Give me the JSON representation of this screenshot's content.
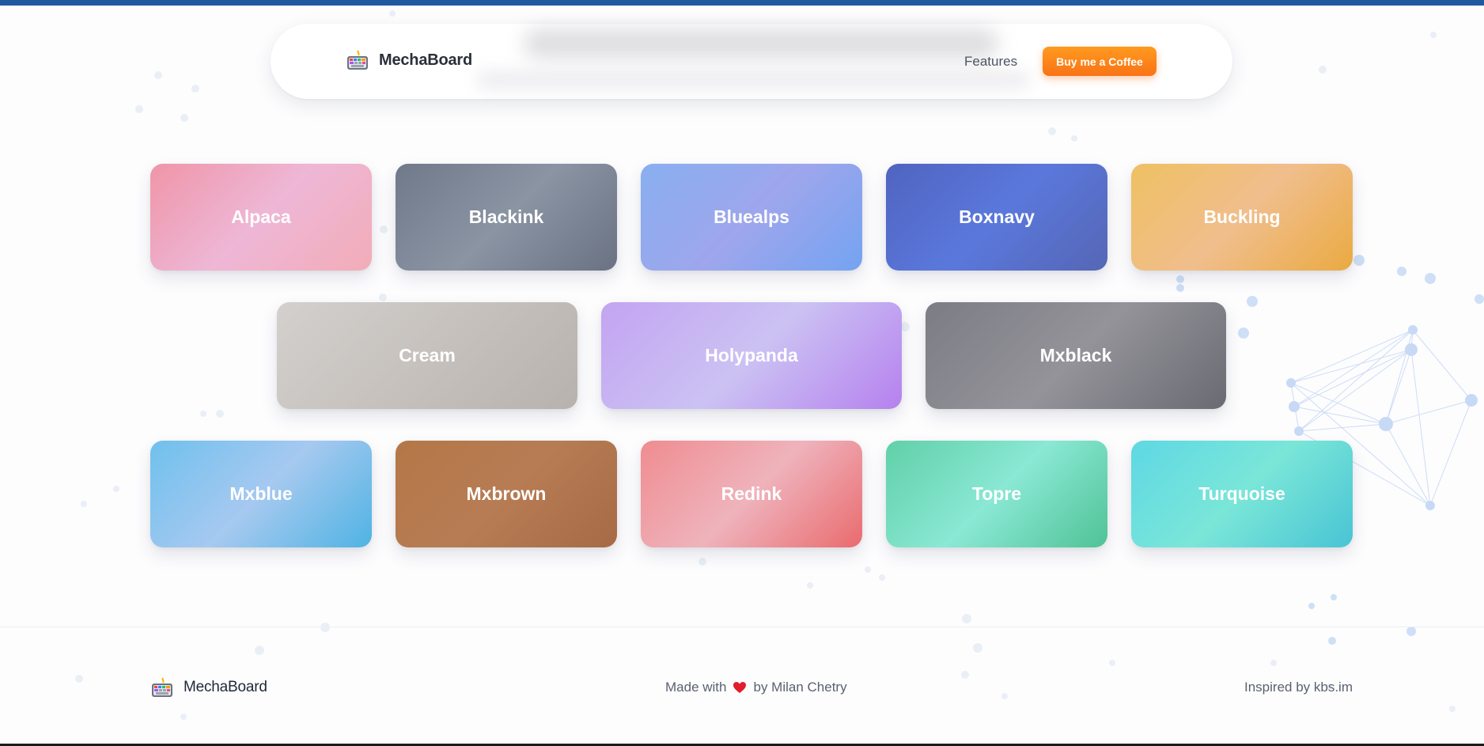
{
  "app": {
    "name": "MechaBoard"
  },
  "header": {
    "brand": "MechaBoard",
    "brand_icon": "keyboard-icon",
    "nav": [
      {
        "label": "Features"
      }
    ],
    "cta_label": "Buy me a Coffee",
    "cta_color": "#f97316"
  },
  "switches": [
    {
      "label": "Alpaca",
      "colors": [
        "#ef95a8",
        "#eeb7d6",
        "#f2acb8"
      ]
    },
    {
      "label": "Blackink",
      "colors": [
        "#70798a",
        "#8a94a3",
        "#6a7283"
      ]
    },
    {
      "label": "Bluealps",
      "colors": [
        "#88aff0",
        "#9ea6ec",
        "#74a3f1"
      ]
    },
    {
      "label": "Boxnavy",
      "colors": [
        "#5064c0",
        "#5a78dc",
        "#5566b5"
      ]
    },
    {
      "label": "Buckling",
      "colors": [
        "#efc063",
        "#f0be8c",
        "#eaaa42"
      ]
    },
    {
      "label": "Cream",
      "colors": [
        "#d3d0cd",
        "#c6c1bd",
        "#b8b2ae"
      ]
    },
    {
      "label": "Holypanda",
      "colors": [
        "#c3a4f1",
        "#cbc2f3",
        "#b581ee"
      ]
    },
    {
      "label": "Mxblack",
      "colors": [
        "#7c7c84",
        "#94939a",
        "#6a6a72"
      ]
    },
    {
      "label": "Mxblue",
      "colors": [
        "#6fc0ee",
        "#a6c9f0",
        "#4fb3e3"
      ]
    },
    {
      "label": "Mxbrown",
      "colors": [
        "#b47747",
        "#b77c54",
        "#a66b45"
      ]
    },
    {
      "label": "Redink",
      "colors": [
        "#ef8c90",
        "#efb3bc",
        "#e96b6e"
      ]
    },
    {
      "label": "Topre",
      "colors": [
        "#60d0a8",
        "#8ae8d4",
        "#4fc396"
      ]
    },
    {
      "label": "Turquoise",
      "colors": [
        "#5ed8e4",
        "#7ae6d8",
        "#48c4d4"
      ]
    }
  ],
  "footer": {
    "brand": "MechaBoard",
    "made_prefix": "Made with",
    "made_suffix": "by Milan Chetry",
    "heart_icon": "heart-icon",
    "heart_color": "#e11d2e",
    "inspired": "Inspired by kbs.im"
  },
  "colors": {
    "top_accent": "#1f5aa0",
    "background": "#fdfdfe"
  }
}
